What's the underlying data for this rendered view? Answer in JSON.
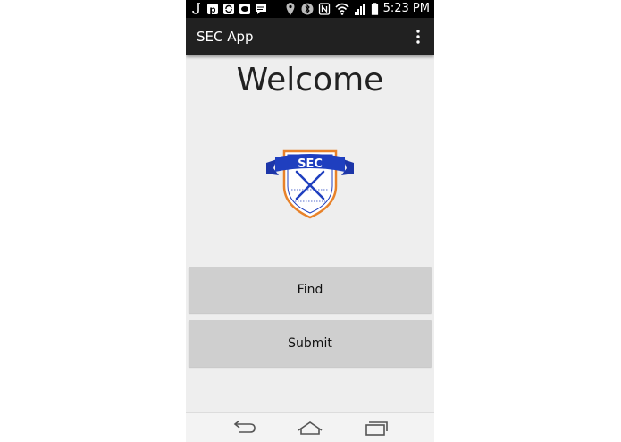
{
  "status_bar": {
    "time": "5:23 PM",
    "left_icons": [
      "j-notification-icon",
      "pinterest-icon",
      "sync-icon",
      "line-icon",
      "chat-icon"
    ],
    "right_icons": [
      "location-icon",
      "bluetooth-icon",
      "nfc-icon",
      "wifi-icon",
      "signal-icon",
      "battery-icon"
    ]
  },
  "action_bar": {
    "title": "SEC App",
    "overflow_icon": "overflow-menu-icon"
  },
  "main": {
    "heading": "Welcome",
    "logo_text": "SEC",
    "buttons": {
      "find": "Find",
      "submit": "Submit"
    }
  },
  "nav_bar": {
    "icons": [
      "back-icon",
      "home-icon",
      "recent-apps-icon"
    ]
  },
  "colors": {
    "status_bar_bg": "#000000",
    "action_bar_bg": "#212121",
    "content_bg": "#eeeeee",
    "button_bg": "#cfcfcf",
    "logo_blue": "#1f3fbf",
    "logo_orange": "#e8822a"
  }
}
